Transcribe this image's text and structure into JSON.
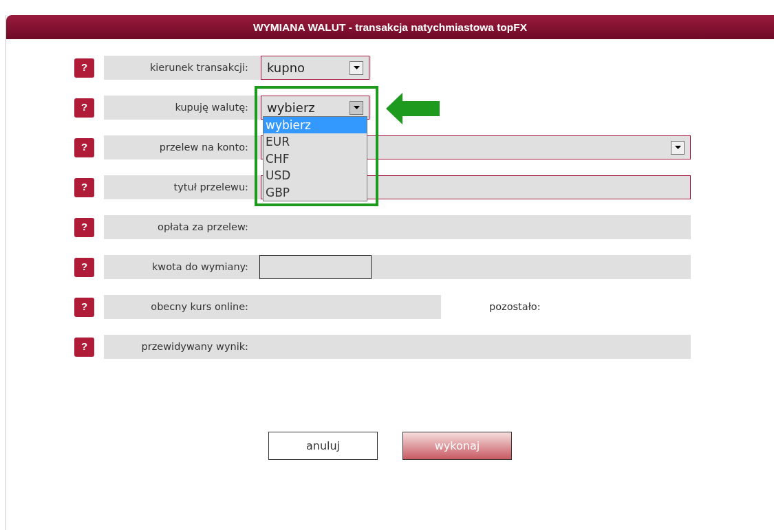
{
  "header": {
    "title": "WYMIANA WALUT - transakcja natychmiastowa topFX"
  },
  "rows": [
    {
      "help": "?",
      "kind": "select",
      "label": "kierunek transakcji:",
      "value": "kupno",
      "expanded": false
    },
    {
      "help": "?",
      "kind": "select",
      "label": "kupuję walutę:",
      "value": "wybierz",
      "expanded": true,
      "annotated": true,
      "options": [
        {
          "label": "wybierz",
          "selected": true
        },
        {
          "label": "EUR",
          "selected": false
        },
        {
          "label": "CHF",
          "selected": false
        },
        {
          "label": "USD",
          "selected": false
        },
        {
          "label": "GBP",
          "selected": false
        }
      ]
    },
    {
      "help": "?",
      "kind": "select-wide",
      "label": "przelew na konto:"
    },
    {
      "help": "?",
      "kind": "input-wide",
      "label": "tytuł przelewu:"
    },
    {
      "help": "?",
      "kind": "info",
      "label": "opłata za przelew:"
    },
    {
      "help": "?",
      "kind": "input",
      "label": "kwota do wymiany:"
    },
    {
      "help": "?",
      "kind": "info-short",
      "label": "obecny kurs online:",
      "side_label": "pozostało:"
    },
    {
      "help": "?",
      "kind": "info",
      "label": "przewidywany wynik:"
    }
  ],
  "buttons": [
    {
      "label": "anuluj",
      "disabled": false
    },
    {
      "label": "wykonaj",
      "disabled": true
    }
  ]
}
